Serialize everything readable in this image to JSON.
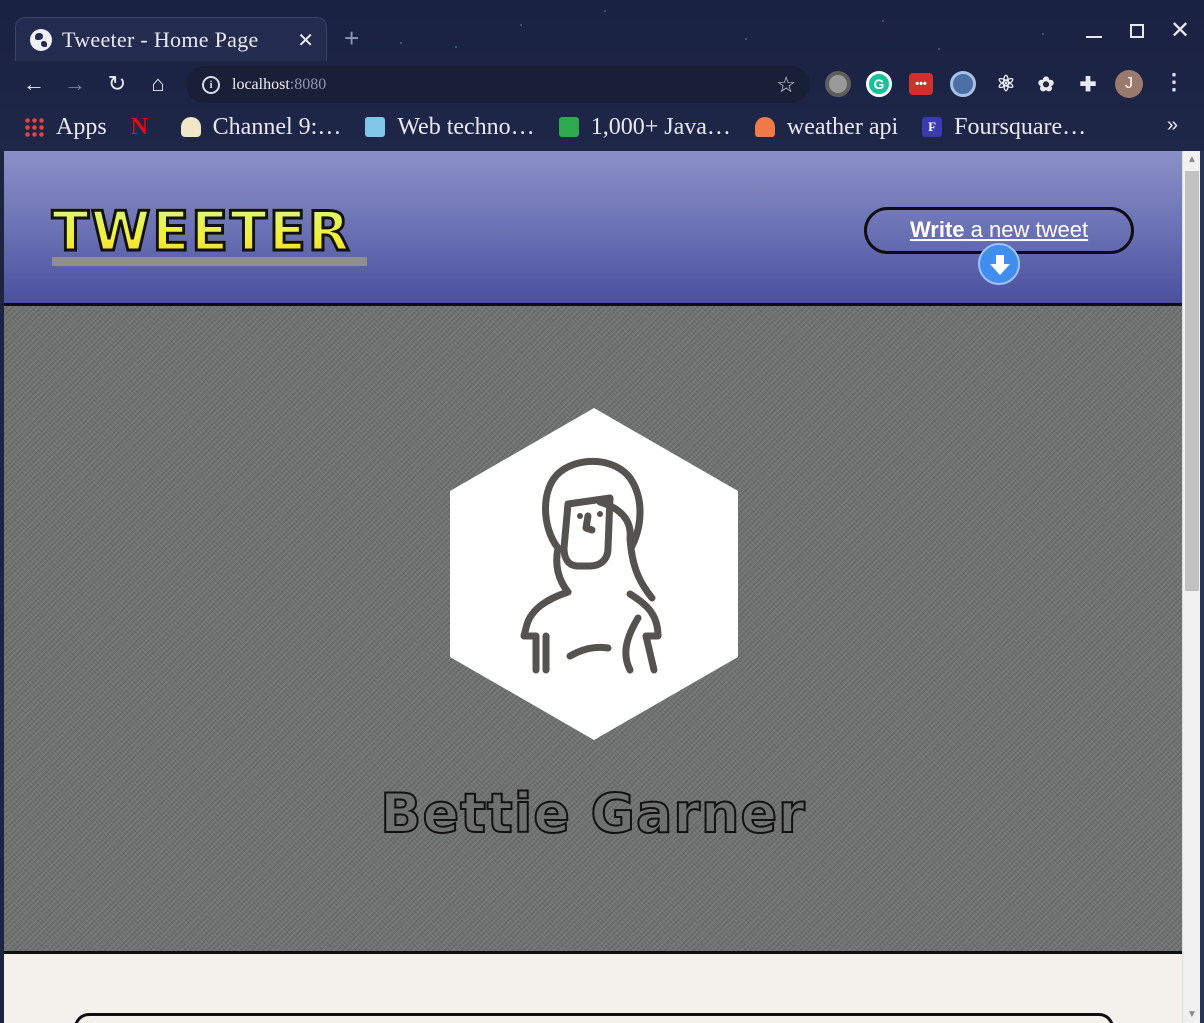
{
  "browser": {
    "tab_title": "Tweeter - Home Page",
    "url_host": "localhost",
    "url_port": ":8080",
    "profile_initial": "J",
    "bookmarks": [
      {
        "label": "Apps",
        "icon": "apps-grid-icon",
        "color": "#e8433a"
      },
      {
        "label": "",
        "icon": "netflix-icon",
        "color": "#e50914"
      },
      {
        "label": "Channel 9:…",
        "icon": "channel9-icon",
        "color": "#f2e6c8"
      },
      {
        "label": "Web techno…",
        "icon": "mdn-icon",
        "color": "#7fc6e8"
      },
      {
        "label": "1,000+ Java…",
        "icon": "java-icon",
        "color": "#2fa84f"
      },
      {
        "label": "weather api",
        "icon": "weather-icon",
        "color": "#f07a4a"
      },
      {
        "label": "Foursquare…",
        "icon": "foursquare-icon",
        "color": "#3b3bb0"
      }
    ]
  },
  "header": {
    "logo": "TWEETER",
    "write_bold": "Write",
    "write_rest": " a new tweet"
  },
  "profile": {
    "name": "Bettie Garner",
    "avatar_icon": "woman-avatar-icon"
  }
}
